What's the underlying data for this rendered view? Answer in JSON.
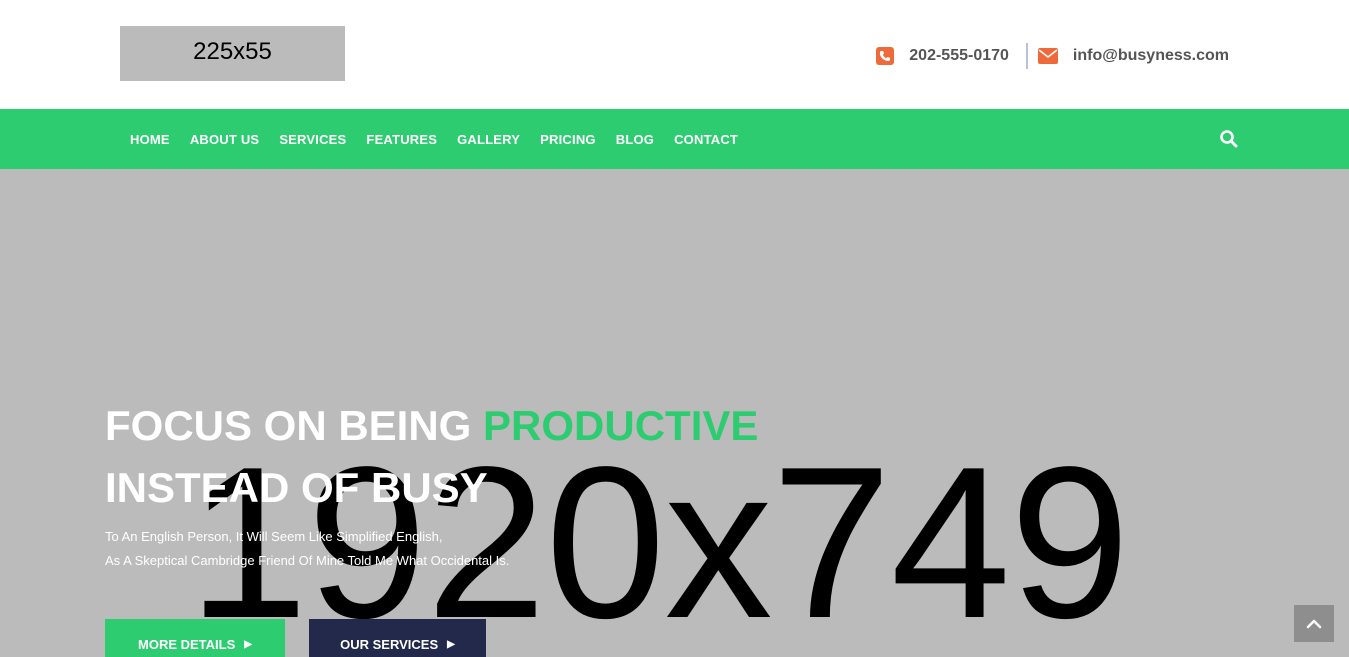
{
  "header": {
    "logo_text": "225x55",
    "phone": "202-555-0170",
    "email": "info@busyness.com",
    "icon_color": "#ee6a3a"
  },
  "nav": {
    "items": [
      {
        "label": "HOME"
      },
      {
        "label": "ABOUT US"
      },
      {
        "label": "SERVICES"
      },
      {
        "label": "FEATURES"
      },
      {
        "label": "GALLERY"
      },
      {
        "label": "PRICING"
      },
      {
        "label": "BLOG"
      },
      {
        "label": "CONTACT"
      }
    ],
    "search_icon": "search-icon",
    "background": "#2ecc71"
  },
  "hero": {
    "placeholder_text": "1920x749",
    "headline_part1": "FOCUS ON BEING ",
    "headline_accent": "PRODUCTIVE",
    "headline_line2": "INSTEAD OF BUSY",
    "sub_line1": "To An English Person, It Will Seem Like Simplified English,",
    "sub_line2": "As A Skeptical Cambridge Friend Of Mine Told Me What Occidental Is.",
    "btn_more": "MORE DETAILS",
    "btn_services": "OUR SERVICES"
  },
  "colors": {
    "accent": "#2ecc71",
    "dark_button": "#22294a",
    "hero_bg": "#bbbbbb"
  }
}
